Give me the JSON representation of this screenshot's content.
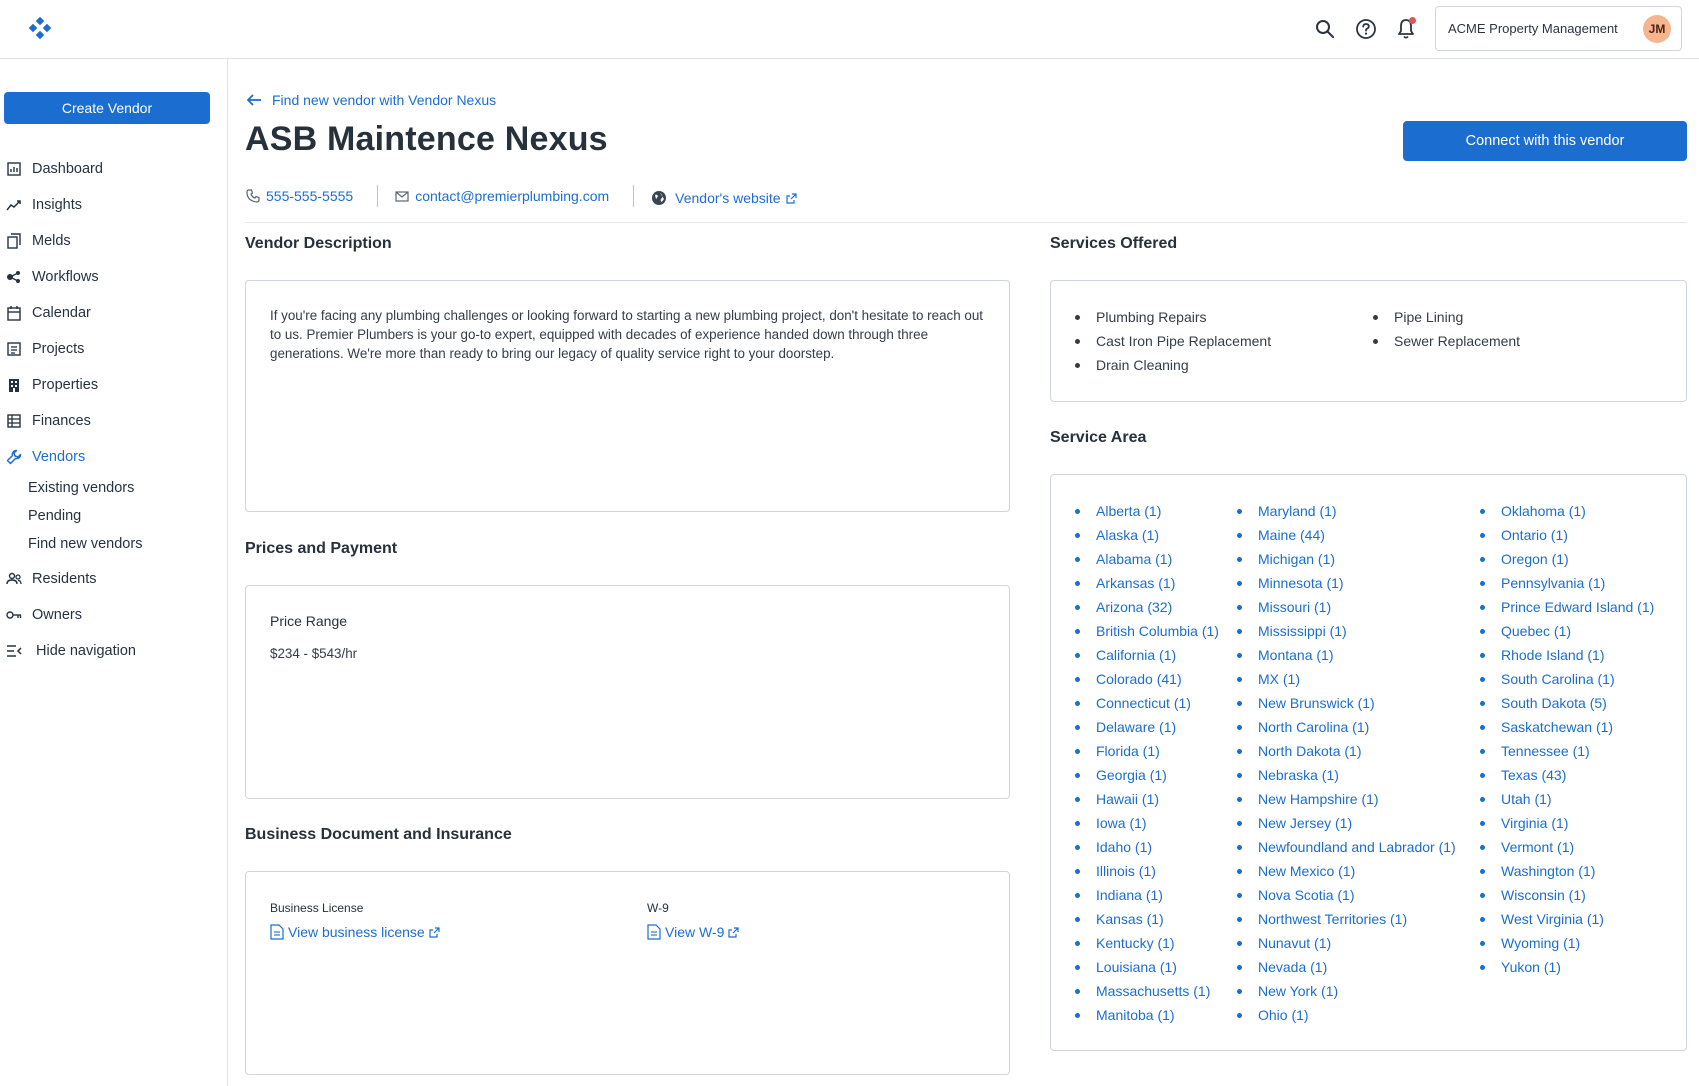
{
  "app": {
    "org_name": "ACME Property Management",
    "user_initials": "JM",
    "colors": {
      "accent": "#1b6ed0",
      "avatar": "#f6b48f",
      "notification": "#e8505b"
    }
  },
  "topbar": {
    "icons": [
      "search-icon",
      "help-icon",
      "bell-icon"
    ]
  },
  "sidebar": {
    "create_label": "Create Vendor",
    "items": [
      {
        "label": "Dashboard",
        "icon": "dashboard-icon"
      },
      {
        "label": "Insights",
        "icon": "insights-icon"
      },
      {
        "label": "Melds",
        "icon": "melds-icon"
      },
      {
        "label": "Workflows",
        "icon": "workflows-icon"
      },
      {
        "label": "Calendar",
        "icon": "calendar-icon"
      },
      {
        "label": "Projects",
        "icon": "projects-icon"
      },
      {
        "label": "Properties",
        "icon": "properties-icon"
      },
      {
        "label": "Finances",
        "icon": "finances-icon"
      },
      {
        "label": "Vendors",
        "icon": "wrench-icon",
        "active": true
      },
      {
        "label": "Residents",
        "icon": "residents-icon"
      },
      {
        "label": "Owners",
        "icon": "key-icon"
      },
      {
        "label": "Hide navigation",
        "icon": "hide-nav-icon"
      }
    ],
    "sub_items": [
      "Existing vendors",
      "Pending",
      "Find new vendors"
    ]
  },
  "main": {
    "back_link": "Find new vendor with Vendor Nexus",
    "title": "ASB Maintence Nexus",
    "connect_label": "Connect with this vendor",
    "phone": "555-555-5555",
    "email": "contact@premierplumbing.com",
    "website": "Vendor's website",
    "description": {
      "heading": "Vendor Description",
      "text": "If you're facing any plumbing challenges or looking forward to starting a new plumbing project, don't hesitate to reach out to us. Premier Plumbers is your go-to expert, equipped with decades of experience handed down through three generations. We're more than ready to bring our legacy of quality service right to your doorstep."
    },
    "prices": {
      "heading": "Prices and Payment",
      "label": "Price Range",
      "value": "$234 - $543/hr"
    },
    "documents": {
      "heading": "Business Document and Insurance",
      "license_label": "Business License",
      "license_link": "View business license",
      "w9_label": "W-9",
      "w9_link": "View W-9"
    },
    "services": {
      "heading": "Services Offered",
      "col1": [
        "Plumbing Repairs",
        "Cast Iron Pipe Replacement",
        "Drain Cleaning"
      ],
      "col2": [
        "Pipe Lining",
        "Sewer Replacement"
      ]
    },
    "service_area": {
      "heading": "Service Area",
      "col1": [
        "Alberta (1)",
        "Alaska (1)",
        "Alabama (1)",
        "Arkansas (1)",
        "Arizona (32)",
        "British Columbia (1)",
        "California (1)",
        "Colorado (41)",
        "Connecticut (1)",
        "Delaware (1)",
        "Florida (1)",
        "Georgia (1)",
        "Hawaii (1)",
        "Iowa (1)",
        "Idaho (1)",
        "Illinois (1)",
        "Indiana (1)",
        "Kansas (1)",
        "Kentucky (1)",
        "Louisiana (1)",
        "Massachusetts (1)",
        "Manitoba (1)"
      ],
      "col2": [
        "Maryland (1)",
        "Maine (44)",
        "Michigan (1)",
        "Minnesota (1)",
        "Missouri (1)",
        "Mississippi (1)",
        "Montana (1)",
        "MX (1)",
        "New Brunswick (1)",
        "North Carolina (1)",
        "North Dakota (1)",
        "Nebraska (1)",
        "New Hampshire (1)",
        "New Jersey (1)",
        "Newfoundland and Labrador (1)",
        "New Mexico (1)",
        "Nova Scotia (1)",
        "Northwest Territories (1)",
        "Nunavut (1)",
        "Nevada (1)",
        "New York (1)",
        "Ohio (1)"
      ],
      "col3": [
        "Oklahoma (1)",
        "Ontario (1)",
        "Oregon (1)",
        "Pennsylvania (1)",
        "Prince Edward Island (1)",
        "Quebec (1)",
        "Rhode Island (1)",
        "South Carolina (1)",
        "South Dakota (5)",
        "Saskatchewan (1)",
        "Tennessee (1)",
        "Texas (43)",
        "Utah (1)",
        "Virginia (1)",
        "Vermont (1)",
        "Washington (1)",
        "Wisconsin (1)",
        "West Virginia (1)",
        "Wyoming (1)",
        "Yukon (1)"
      ]
    }
  }
}
